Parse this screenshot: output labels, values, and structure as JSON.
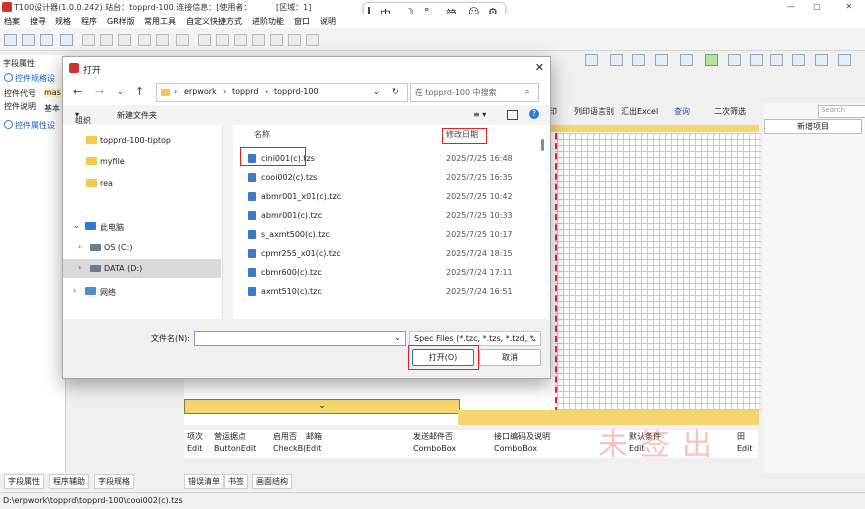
{
  "app": {
    "title": "T100设计器(1.0.0.242) 站台：topprd-100 连接信息：[使用者：",
    "region": "[区域：1]",
    "menu": [
      "档案",
      "搜寻",
      "规格",
      "程序",
      "GR样版",
      "常用工具",
      "自定义快捷方式",
      "进阶功能",
      "窗口",
      "说明"
    ]
  },
  "ime": {
    "items": [
      "中",
      "☽",
      "°,",
      "简",
      "☺",
      "⚙"
    ]
  },
  "left_panel": {
    "header": "字段属性",
    "section1": "控件规格设",
    "field_code_label": "控件代号",
    "field_code_value": "mas",
    "field_desc_label": "控件说明",
    "field_desc_value": "基本",
    "section2": "控件属性设",
    "tabs": [
      "字段属性",
      "程序辅助",
      "字段规格"
    ]
  },
  "ribbon_right": {
    "items": [
      "印",
      "列印语言别",
      "汇出Excel",
      "查询",
      "二次筛选"
    ],
    "search_placeholder": "Search",
    "new_item": "新增项目"
  },
  "grid_table": {
    "headers": [
      "项次",
      "营运据点",
      "启用否",
      "邮箱",
      "发送邮件否",
      "接口编码及说明",
      "默认条件",
      "田"
    ],
    "cells": [
      "Edit",
      "ButtonEdit",
      "CheckB(",
      "Edit",
      "ComboBox",
      "ComboBox",
      "Edit",
      "Edit"
    ]
  },
  "watermark": "未签出",
  "bottom_tabs": [
    "错误清单",
    "书签",
    "画面结构"
  ],
  "statusbar": "D:\\erpwork\\topprd\\topprd-100\\cooi002(c).tzs",
  "dialog": {
    "title": "打开",
    "breadcrumb": [
      "erpwork",
      "topprd",
      "topprd-100"
    ],
    "search_placeholder": "在 topprd-100 中搜索",
    "organize": "组织",
    "new_folder": "新建文件夹",
    "nav_items": [
      {
        "label": "topprd-100-tiptop",
        "kind": "folder"
      },
      {
        "label": "myfile",
        "kind": "folder"
      },
      {
        "label": "rea",
        "kind": "folder"
      },
      {
        "label": "此电脑",
        "kind": "pc"
      },
      {
        "label": "OS (C:)",
        "kind": "drive"
      },
      {
        "label": "DATA (D:)",
        "kind": "drive"
      },
      {
        "label": "网络",
        "kind": "net"
      }
    ],
    "col_name": "名称",
    "col_date": "修改日期",
    "files": [
      {
        "name": "cini001(c).tzs",
        "date": "2025/7/25 16:48"
      },
      {
        "name": "cooi002(c).tzs",
        "date": "2025/7/25 16:35"
      },
      {
        "name": "abmr001_x01(c).tzc",
        "date": "2025/7/25 10:42"
      },
      {
        "name": "abmr001(c).tzc",
        "date": "2025/7/25 10:33"
      },
      {
        "name": "s_axmt500(c).tzc",
        "date": "2025/7/25 10:17"
      },
      {
        "name": "cpmr255_x01(c).tzc",
        "date": "2025/7/24 18:15"
      },
      {
        "name": "cbmr600(c).tzc",
        "date": "2025/7/24 17:11"
      },
      {
        "name": "axmt510(c).tzc",
        "date": "2025/7/24 16:51"
      }
    ],
    "filename_label": "文件名(N):",
    "filename_value": "",
    "filetype": "Spec Files (*.tzc, *.tzs, *.tzd, *.",
    "open_button": "打开(O)",
    "cancel_button": "取消"
  },
  "colors": {
    "accent": "#2b6cd0",
    "highlight_red": "#e02424",
    "canvas_yellow": "#f5d56e"
  }
}
